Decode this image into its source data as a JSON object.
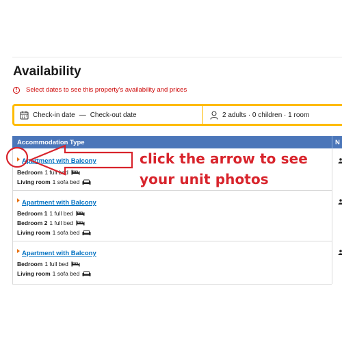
{
  "section": {
    "title": "Availability"
  },
  "alert": {
    "icon": "alert-circle-icon",
    "text": "Select dates to see this property's availability and prices"
  },
  "search": {
    "date_icon": "calendar-icon",
    "checkin": "Check-in date",
    "dash": "—",
    "checkout": "Check-out date",
    "guests_icon": "person-icon",
    "guests": "2 adults · 0 children · 1 room"
  },
  "table": {
    "headers": {
      "type": "Accommodation Type",
      "next": "N"
    },
    "rows": [
      {
        "name": "Apartment with Balcony",
        "beds": [
          {
            "label": "Bedroom",
            "value": "1 full bed",
            "icon": "double-bed-icon"
          },
          {
            "label": "Living room",
            "value": "1 sofa bed",
            "icon": "sofa-bed-icon"
          }
        ]
      },
      {
        "name": "Apartment with Balcony",
        "beds": [
          {
            "label": "Bedroom 1",
            "value": "1 full bed",
            "icon": "double-bed-icon"
          },
          {
            "label": "Bedroom 2",
            "value": "1 full bed",
            "icon": "double-bed-icon"
          },
          {
            "label": "Living room",
            "value": "1 sofa bed",
            "icon": "sofa-bed-icon"
          }
        ]
      },
      {
        "name": "Apartment with Balcony",
        "beds": [
          {
            "label": "Bedroom",
            "value": "1 full bed",
            "icon": "double-bed-icon"
          },
          {
            "label": "Living room",
            "value": "1 sofa bed",
            "icon": "sofa-bed-icon"
          }
        ]
      }
    ]
  },
  "annotation": {
    "line1": "click the arrow to see",
    "line2": "your unit photos",
    "color": "#d8242c"
  },
  "colors": {
    "accent": "#febb02",
    "header_bg": "#4b76b9",
    "link": "#0071c2",
    "alert": "#cc0000",
    "expander": "#e8700f"
  }
}
